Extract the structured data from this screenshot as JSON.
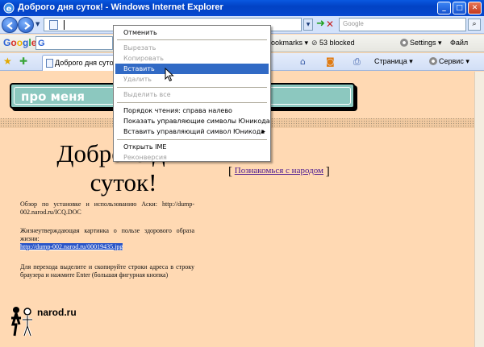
{
  "window": {
    "title": "Доброго дня суток! - Windows Internet Explorer",
    "minimize": "_",
    "maximize": "□",
    "close": "✕"
  },
  "address": {
    "search_placeholder": "Google",
    "search_icon": "magnifier-icon"
  },
  "google_toolbar": {
    "logo": "Google",
    "field_letter": "G",
    "bookmarks": "ookmarks ▾",
    "blocked": "53 blocked",
    "settings": "Settings ▾",
    "file": "Файл"
  },
  "tabs": {
    "active_tab": "Доброго дня суток!",
    "page_menu": "Страница ▾",
    "service_menu": "Сервис ▾"
  },
  "page": {
    "banner": "про меня",
    "heading": "Доброго дня суток!",
    "heading_line1": "Доброго дня",
    "heading_line2": "суток!",
    "link": "Познакомься с народом",
    "p1": "Обзор по установке и использованию Аски: http://dump-002.narod.ru/ICQ.DOC",
    "p2": "Жизнеутверждающая картинка о пользе здорового образа жизни:",
    "p2_link": "http://dump-002.narod.ru/00019435.jpg",
    "p3": "Для перехода выделите и скопируйте строки адреса в строку браузера и нажмите Enter (большая фигурная кнопка)",
    "logo_text": "narod.ru"
  },
  "context_menu": {
    "items": [
      {
        "label": "Отменить",
        "enabled": true
      },
      {
        "label": "Вырезать",
        "enabled": false
      },
      {
        "label": "Копировать",
        "enabled": false
      },
      {
        "label": "Вставить",
        "enabled": true,
        "highlighted": true
      },
      {
        "label": "Удалить",
        "enabled": false
      },
      {
        "label": "Выделить все",
        "enabled": false
      },
      {
        "label": "Порядок чтения: справа налево",
        "enabled": true
      },
      {
        "label": "Показать управляющие символы Юникода",
        "enabled": true
      },
      {
        "label": "Вставить управляющий символ Юникода",
        "enabled": true,
        "submenu": true
      },
      {
        "label": "Открыть IME",
        "enabled": true
      },
      {
        "label": "Реконверсия",
        "enabled": false
      }
    ]
  },
  "colors": {
    "page_bg": "#ffd9b3",
    "banner": "#8cc8bf",
    "menu_highlight": "#316ac5",
    "selection": "#2a55c7"
  }
}
